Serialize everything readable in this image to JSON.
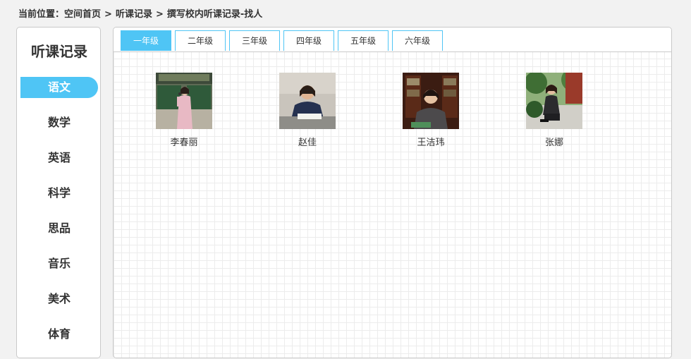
{
  "breadcrumb": {
    "prefix": "当前位置：",
    "home": "空间首页",
    "separator": ">",
    "level2": "听课记录",
    "current": "撰写校内听课记录-找人"
  },
  "sidebar": {
    "title": "听课记录",
    "active_index": 0,
    "items": [
      {
        "label": "语文"
      },
      {
        "label": "数学"
      },
      {
        "label": "英语"
      },
      {
        "label": "科学"
      },
      {
        "label": "思品"
      },
      {
        "label": "音乐"
      },
      {
        "label": "美术"
      },
      {
        "label": "体育"
      }
    ]
  },
  "tabs": {
    "active_index": 0,
    "items": [
      {
        "label": "一年级"
      },
      {
        "label": "二年级"
      },
      {
        "label": "三年级"
      },
      {
        "label": "四年级"
      },
      {
        "label": "五年级"
      },
      {
        "label": "六年级"
      }
    ]
  },
  "teachers": [
    {
      "name": "李春丽"
    },
    {
      "name": "赵佳"
    },
    {
      "name": "王洁玮"
    },
    {
      "name": "张娜"
    }
  ],
  "colors": {
    "accent": "#4fc5f5",
    "background": "#f2f2f2",
    "border": "#c9c9c9",
    "text": "#333333"
  }
}
